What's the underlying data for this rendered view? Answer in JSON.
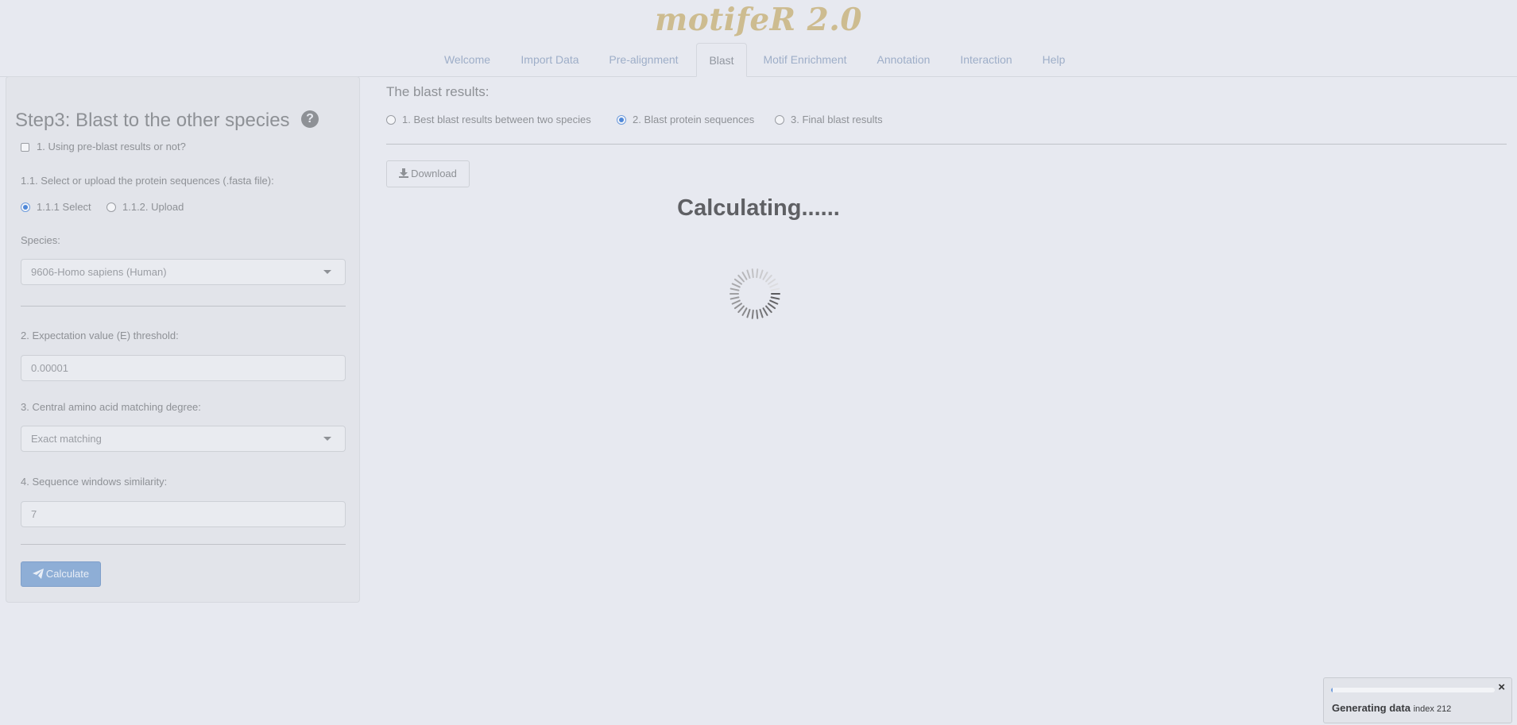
{
  "app": {
    "title": "motifeR 2.0"
  },
  "nav": {
    "tabs": [
      {
        "label": "Welcome"
      },
      {
        "label": "Import Data"
      },
      {
        "label": "Pre-alignment"
      },
      {
        "label": "Blast"
      },
      {
        "label": "Motif Enrichment"
      },
      {
        "label": "Annotation"
      },
      {
        "label": "Interaction"
      },
      {
        "label": "Help"
      }
    ],
    "active": "Blast"
  },
  "sidebar": {
    "title": "Step3: Blast to the other species",
    "help_icon": "question-circle-icon",
    "preblast_label": "1. Using pre-blast results or not?",
    "preblast_checked": false,
    "select_upload_label": "1.1. Select or upload the protein sequences (.fasta file):",
    "source_options": [
      "1.1.1 Select",
      "1.1.2. Upload"
    ],
    "source_selected": "1.1.1 Select",
    "species_label": "Species:",
    "species_value": "9606-Homo sapiens (Human)",
    "evalue_label": "2. Expectation value (E) threshold:",
    "evalue_value": "0.00001",
    "central_label": "3. Central amino acid matching degree:",
    "central_value": "Exact matching",
    "similarity_label": "4. Sequence windows similarity:",
    "similarity_value": "7",
    "calculate_label": "Calculate",
    "calculate_icon": "paper-plane-icon"
  },
  "main": {
    "title": "The blast results:",
    "result_options": [
      "1. Best blast results between two species",
      "2. Blast protein sequences",
      "3. Final blast results"
    ],
    "result_selected": "2. Blast protein sequences",
    "download_label": "Download",
    "download_icon": "download-icon",
    "calculating_text": "Calculating......"
  },
  "notification": {
    "message": "Generating data",
    "detail": "index 212",
    "progress_fraction": 0.01,
    "close_symbol": "×"
  },
  "colors": {
    "background": "#e7e9f0",
    "accent": "#4f88d8",
    "title": "#cdbc90",
    "calculate_button": "#8eaed6"
  }
}
